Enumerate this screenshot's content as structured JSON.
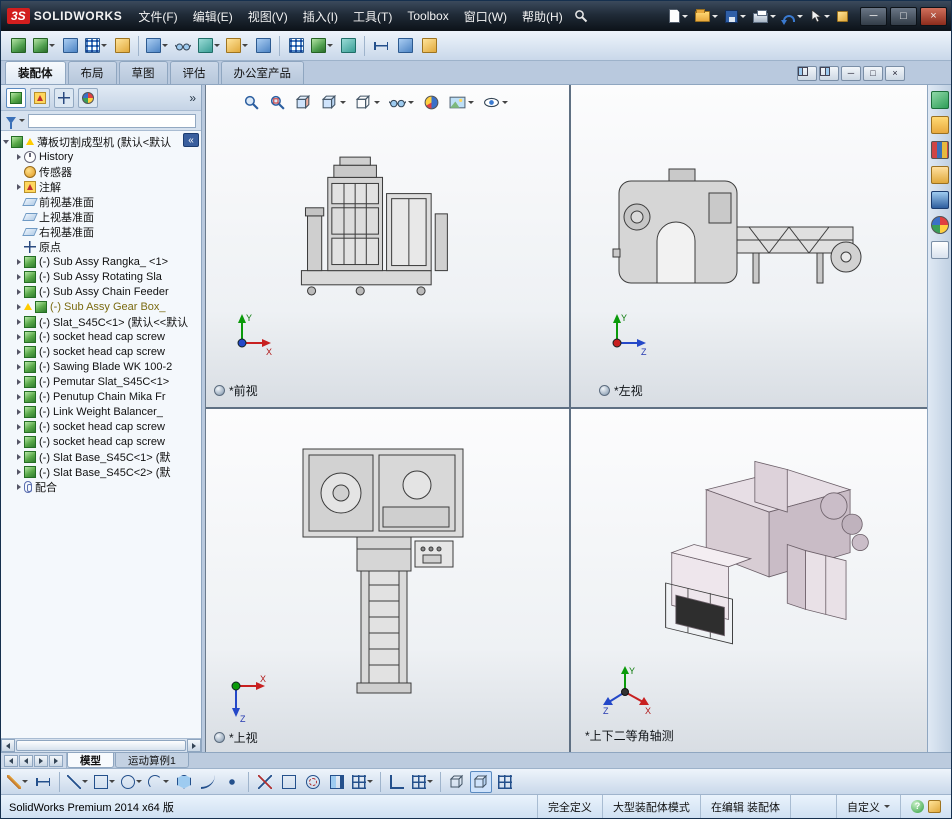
{
  "icons": {
    "minimize": "─",
    "maximize": "□",
    "restore": "□",
    "close": "×",
    "chevrons_right": "»",
    "chevrons_left": "«",
    "help": "?"
  },
  "titlebar": {
    "logo_mark": "3S",
    "logo_text": "SOLIDWORKS",
    "menus": [
      "文件(F)",
      "编辑(E)",
      "视图(V)",
      "插入(I)",
      "工具(T)",
      "Toolbox",
      "窗口(W)",
      "帮助(H)"
    ]
  },
  "ribbon": {
    "tabs": [
      "装配体",
      "布局",
      "草图",
      "评估",
      "办公室产品"
    ]
  },
  "feature_tree": {
    "root": "薄板切割成型机 (默认<默认",
    "items": [
      "History",
      "传感器",
      "注解",
      "前视基准面",
      "上视基准面",
      "右视基准面",
      "原点",
      "(-) Sub Assy Rangka_ <1>",
      "(-) Sub Assy Rotating Sla",
      "(-) Sub Assy Chain Feeder",
      "(-) Sub Assy Gear Box_",
      "(-) Slat_S45C<1> (默认<<默认",
      "(-) socket head cap screw",
      "(-) socket head cap screw",
      "(-) Sawing Blade WK 100-2",
      "(-) Pemutar Slat_S45C<1>",
      "(-) Penutup Chain Mika Fr",
      "(-) Link Weight Balancer_",
      "(-) socket head cap screw",
      "(-) socket head cap screw",
      "(-) Slat Base_S45C<1> (默",
      "(-) Slat Base_S45C<2> (默",
      "配合"
    ]
  },
  "viewports": [
    {
      "label": "*前视",
      "axes": {
        "a1": "Y",
        "a2": "X"
      }
    },
    {
      "label": "*左视",
      "axes": {
        "a1": "Y",
        "a2": "Z"
      }
    },
    {
      "label": "*上视",
      "axes": {
        "a1": "X",
        "a2": "Z"
      }
    },
    {
      "label": "*上下二等角轴测",
      "axes": {
        "a1": "Y",
        "a2": "X",
        "a3": "Z"
      }
    }
  ],
  "model_tabs": [
    "模型",
    "运动算例1"
  ],
  "statusbar": {
    "product": "SolidWorks Premium 2014 x64 版",
    "define_state": "完全定义",
    "mode": "大型装配体模式",
    "editing": "在编辑 装配体",
    "customize": "自定义"
  }
}
